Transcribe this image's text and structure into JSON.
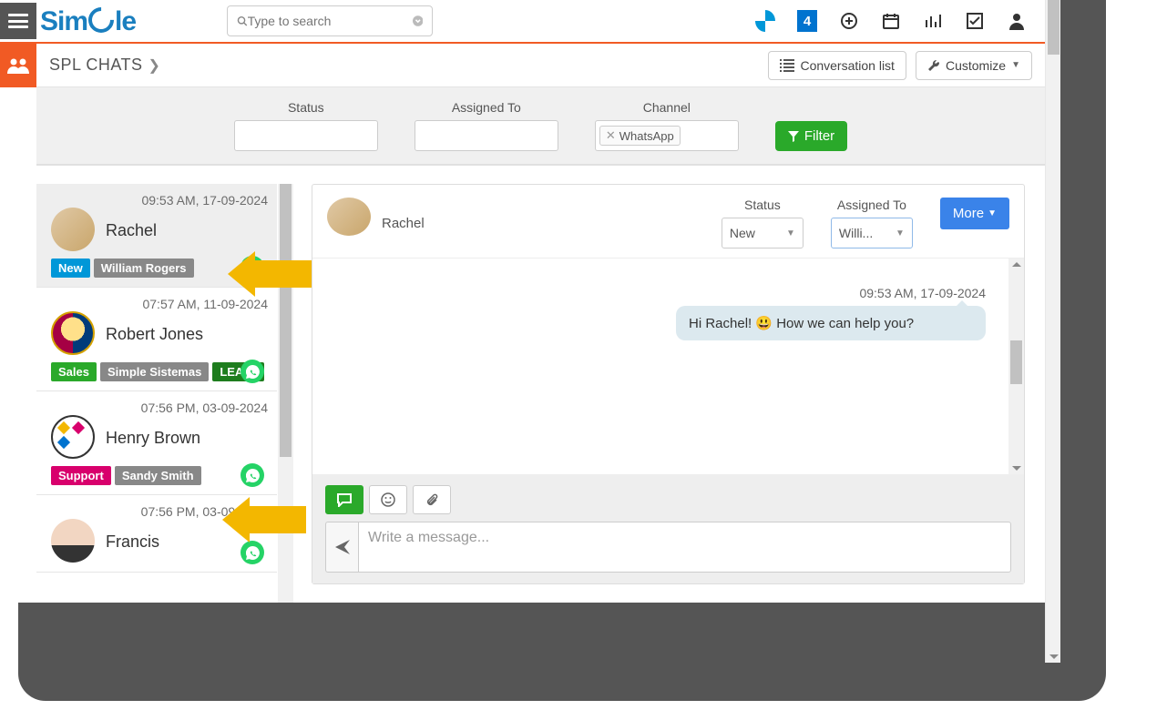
{
  "topbar": {
    "logo_text": "Simple",
    "search_placeholder": "Type to search",
    "icons": {
      "four_label": "4"
    }
  },
  "page": {
    "title": "SPL CHATS",
    "conversation_list_btn": "Conversation list",
    "customize_btn": "Customize"
  },
  "filters": {
    "status_label": "Status",
    "assigned_label": "Assigned To",
    "channel_label": "Channel",
    "channel_chip": "WhatsApp",
    "filter_btn": "Filter"
  },
  "chatlist": [
    {
      "time": "09:53 AM, 17-09-2024",
      "name": "Rachel",
      "tags": [
        {
          "label": "New",
          "cls": "blue"
        },
        {
          "label": "William Rogers",
          "cls": "gray"
        }
      ],
      "active": true
    },
    {
      "time": "07:57 AM, 11-09-2024",
      "name": "Robert Jones",
      "tags": [
        {
          "label": "Sales",
          "cls": "green"
        },
        {
          "label": "Simple Sistemas",
          "cls": "gray"
        },
        {
          "label": "LEA17",
          "cls": "darkgreen"
        }
      ]
    },
    {
      "time": "07:56 PM, 03-09-2024",
      "name": "Henry Brown",
      "tags": [
        {
          "label": "Support",
          "cls": "magenta"
        },
        {
          "label": "Sandy Smith",
          "cls": "gray"
        }
      ]
    },
    {
      "time": "07:56 PM, 03-09-2024",
      "name": "Francis"
    }
  ],
  "chatpane": {
    "contact_name": "Rachel",
    "status_label": "Status",
    "status_value": "New",
    "assigned_label": "Assigned To",
    "assigned_value": "Willi...",
    "more_btn": "More",
    "msg_time": "09:53 AM, 17-09-2024",
    "msg_text": "Hi Rachel! 😃 How we can help you?",
    "compose_placeholder": "Write a message..."
  }
}
